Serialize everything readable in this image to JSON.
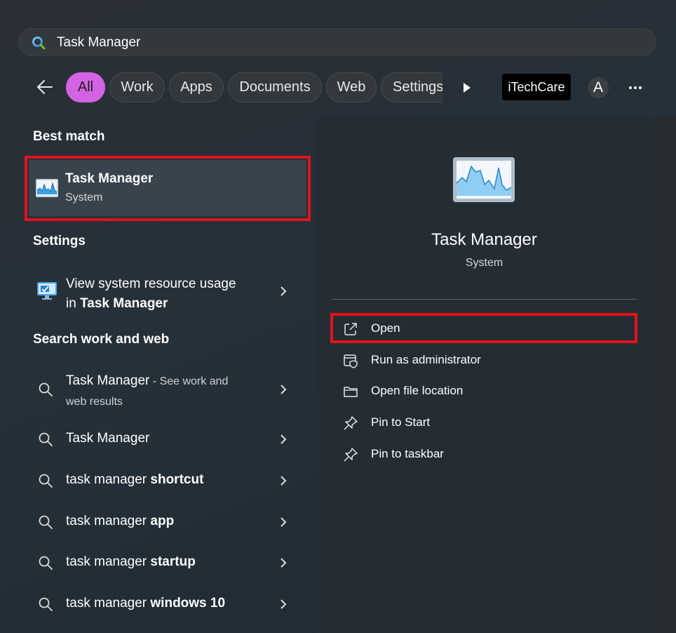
{
  "search": {
    "query": "Task Manager",
    "icon": "search-icon"
  },
  "filters": {
    "back_icon": "back-arrow-icon",
    "items": [
      "All",
      "Work",
      "Apps",
      "Documents",
      "Web",
      "Settings"
    ],
    "active": "All",
    "more_filters_icon": "play-icon"
  },
  "account": {
    "org": "iTechCare",
    "avatar_letter": "A",
    "more_icon": "more-options-icon"
  },
  "best_match": {
    "heading": "Best match",
    "title": "Task Manager",
    "subtitle": "System",
    "icon": "task-manager-icon"
  },
  "settings_section": {
    "heading": "Settings",
    "item_line1": "View system resource usage",
    "item_line2_prefix": "in ",
    "item_line2_bold": "Task Manager",
    "icon": "monitor-settings-icon"
  },
  "web_section": {
    "heading": "Search work and web",
    "first": {
      "term": "Task Manager",
      "suffix_line1": " - See work and",
      "suffix_line2": "web results"
    },
    "items": [
      {
        "normal": "Task Manager",
        "bold": ""
      },
      {
        "normal": "task manager ",
        "bold": "shortcut"
      },
      {
        "normal": "task manager ",
        "bold": "app"
      },
      {
        "normal": "task manager ",
        "bold": "startup"
      },
      {
        "normal": "task manager ",
        "bold": "windows 10"
      }
    ]
  },
  "preview": {
    "title": "Task Manager",
    "subtitle": "System",
    "actions": [
      {
        "label": "Open",
        "icon": "open-external-icon"
      },
      {
        "label": "Run as administrator",
        "icon": "shield-admin-icon"
      },
      {
        "label": "Open file location",
        "icon": "folder-icon"
      },
      {
        "label": "Pin to Start",
        "icon": "pin-icon"
      },
      {
        "label": "Pin to taskbar",
        "icon": "pin-icon"
      }
    ]
  },
  "colors": {
    "accent": "#d363e2",
    "highlight_box": "#e1121c",
    "panel": "#252d34"
  }
}
